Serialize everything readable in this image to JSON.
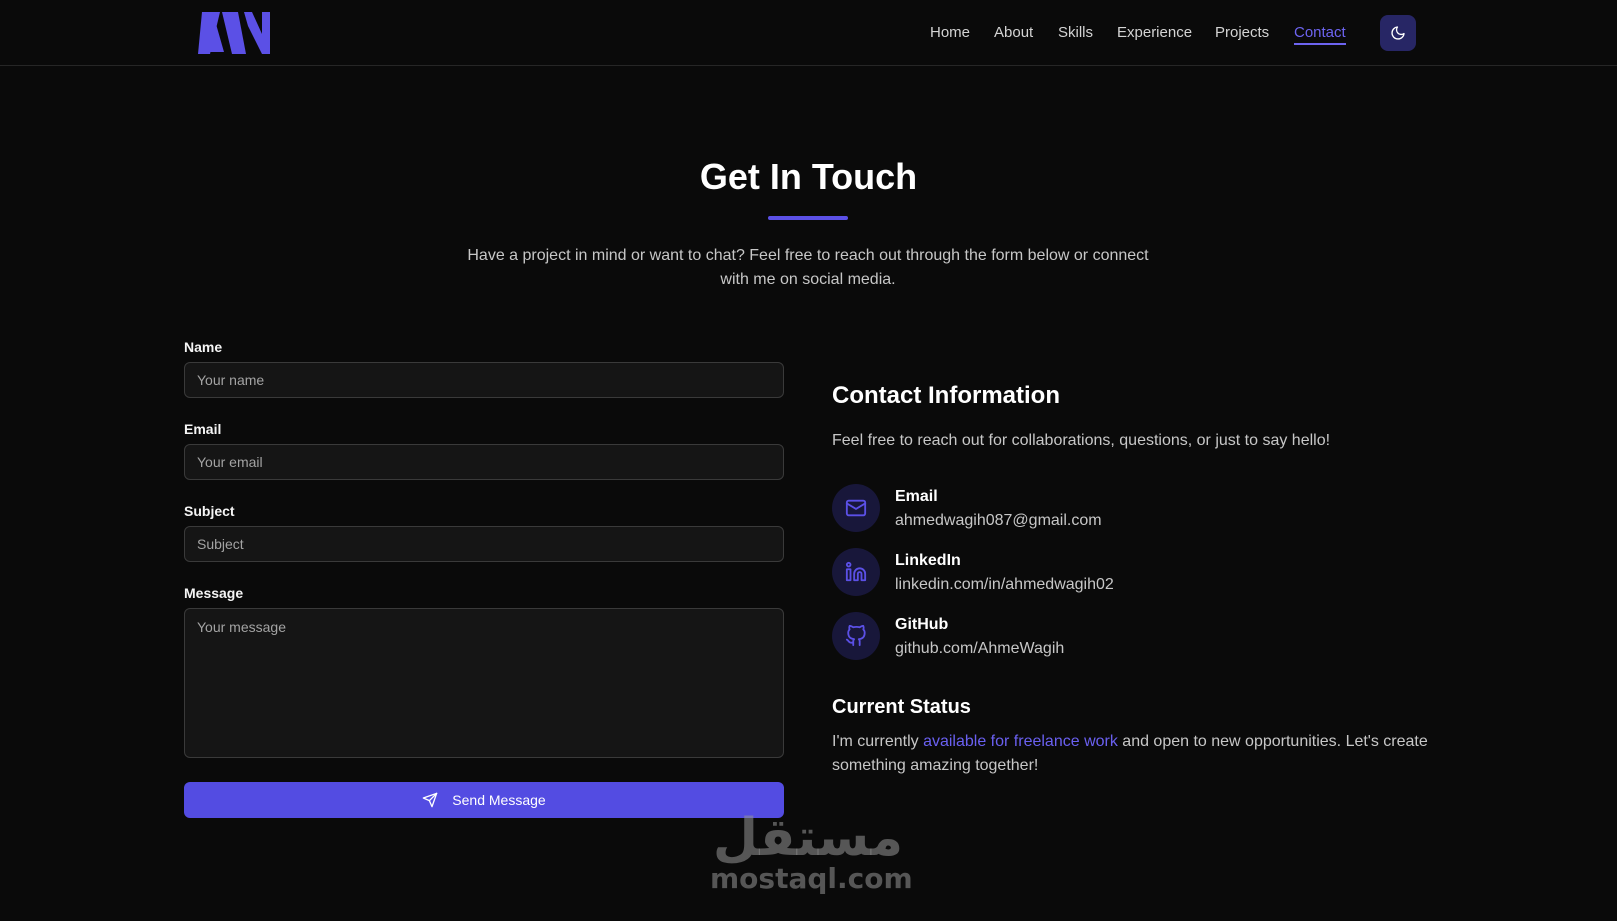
{
  "nav": {
    "links": [
      "Home",
      "About",
      "Skills",
      "Experience",
      "Projects",
      "Contact"
    ],
    "active": "Contact",
    "theme_toggle_icon": "moon-icon"
  },
  "colors": {
    "accent": "#534ce2",
    "background": "#0a0a0a",
    "input_bg": "#151515"
  },
  "hero": {
    "title": "Get In Touch",
    "subtitle": "Have a project in mind or want to chat? Feel free to reach out through the form below or connect with me on social media."
  },
  "form": {
    "name_label": "Name",
    "name_placeholder": "Your name",
    "email_label": "Email",
    "email_placeholder": "Your email",
    "subject_label": "Subject",
    "subject_placeholder": "Subject",
    "message_label": "Message",
    "message_placeholder": "Your message",
    "send_label": "Send Message",
    "send_icon": "paper-plane-icon"
  },
  "contact_info": {
    "title": "Contact Information",
    "description": "Feel free to reach out for collaborations, questions, or just to say hello!",
    "items": [
      {
        "label": "Email",
        "value": "ahmedwagih087@gmail.com",
        "icon": "mail-icon"
      },
      {
        "label": "LinkedIn",
        "value": "linkedin.com/in/ahmedwagih02",
        "icon": "linkedin-icon"
      },
      {
        "label": "GitHub",
        "value": "github.com/AhmeWagih",
        "icon": "github-icon"
      }
    ]
  },
  "status": {
    "title": "Current Status",
    "text_before": "I'm currently ",
    "link_text": "available for freelance work",
    "text_after": " and open to new opportunities. Let's create something amazing together!"
  },
  "watermark": {
    "arabic": "مستقل",
    "latin": "mostaql.com"
  }
}
